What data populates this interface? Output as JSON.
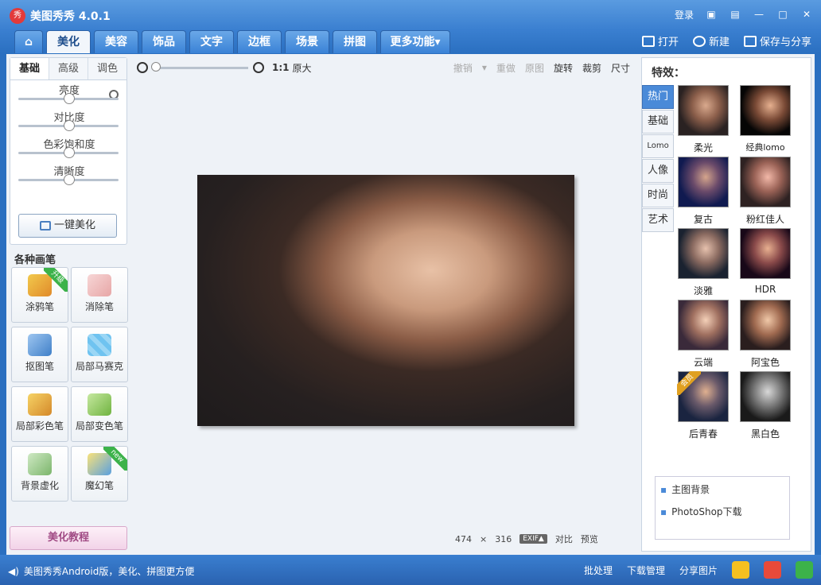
{
  "app": {
    "logo": "秀",
    "title": "美图秀秀 4.0.1",
    "login": "登录"
  },
  "tabs": [
    {
      "label": "⌂"
    },
    {
      "label": "美化"
    },
    {
      "label": "美容"
    },
    {
      "label": "饰品"
    },
    {
      "label": "文字"
    },
    {
      "label": "边框"
    },
    {
      "label": "场景"
    },
    {
      "label": "拼图"
    },
    {
      "label": "更多功能▾"
    }
  ],
  "top_actions": {
    "open": "打开",
    "new": "新建",
    "save": "保存与分享"
  },
  "adjust": {
    "subtabs": [
      "基础",
      "高级",
      "调色"
    ],
    "sliders": [
      {
        "label": "亮度",
        "value": 0.5
      },
      {
        "label": "对比度",
        "value": 0.5
      },
      {
        "label": "色彩饱和度",
        "value": 0.5
      },
      {
        "label": "清晰度",
        "value": 0.5
      }
    ],
    "onekey": "一键美化"
  },
  "brushes": {
    "title": "各种画笔",
    "items": [
      {
        "label": "涂鸦笔",
        "badge": "升级"
      },
      {
        "label": "消除笔",
        "badge": ""
      },
      {
        "label": "抠图笔",
        "badge": ""
      },
      {
        "label": "局部马赛克",
        "badge": ""
      },
      {
        "label": "局部彩色笔",
        "badge": ""
      },
      {
        "label": "局部变色笔",
        "badge": ""
      },
      {
        "label": "背景虚化",
        "badge": ""
      },
      {
        "label": "魔幻笔",
        "badge": "new"
      }
    ]
  },
  "tutorial": "美化教程",
  "toolbar": {
    "zoom_1to1": "1:1",
    "original_size": "原大",
    "undo": "撤销",
    "redo": "重做",
    "orig": "原图",
    "rotate": "旋转",
    "crop": "裁剪",
    "size": "尺寸"
  },
  "image": {
    "width": "474",
    "times": "×",
    "height": "316",
    "exif": "EXIF▲",
    "compare": "对比",
    "preview": "预览"
  },
  "effects": {
    "title": "特效：",
    "categories": [
      "热门",
      "基础",
      "Lomo",
      "人像",
      "时尚",
      "艺术"
    ],
    "items": [
      {
        "label": "柔光",
        "badge": ""
      },
      {
        "label": "经典lomo",
        "badge": ""
      },
      {
        "label": "复古",
        "badge": ""
      },
      {
        "label": "粉红佳人",
        "badge": ""
      },
      {
        "label": "淡雅",
        "badge": ""
      },
      {
        "label": "HDR",
        "badge": ""
      },
      {
        "label": "云端",
        "badge": ""
      },
      {
        "label": "阿宝色",
        "badge": ""
      },
      {
        "label": "后青春",
        "badge": "会员"
      },
      {
        "label": "黑白色",
        "badge": ""
      }
    ],
    "links": [
      "主图背景",
      "PhotoShop下载"
    ]
  },
  "status": {
    "tip": "美图秀秀Android版，美化、拼图更方便",
    "batch": "批处理",
    "download": "下载管理",
    "share": "分享图片"
  }
}
